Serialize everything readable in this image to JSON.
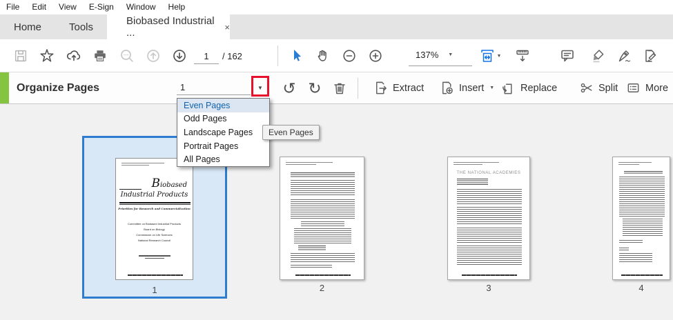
{
  "menu": {
    "items": [
      "File",
      "Edit",
      "View",
      "E-Sign",
      "Window",
      "Help"
    ]
  },
  "tabs": {
    "home": "Home",
    "tools": "Tools",
    "document": "Biobased Industrial ..."
  },
  "toolbar": {
    "page_current": "1",
    "page_total": "/ 162",
    "zoom_level": "137%"
  },
  "organize": {
    "title": "Organize Pages",
    "range_value": "1",
    "actions": {
      "extract": "Extract",
      "insert": "Insert",
      "replace": "Replace",
      "split": "Split",
      "more": "More"
    }
  },
  "dropdown": {
    "items": [
      {
        "label": "Even Pages",
        "highlighted": true
      },
      {
        "label": "Odd Pages"
      },
      {
        "label": "Landscape Pages"
      },
      {
        "label": "Portrait Pages"
      },
      {
        "label": "All Pages"
      }
    ]
  },
  "tooltip": {
    "text": "Even Pages"
  },
  "thumbnails": {
    "page1": {
      "number": "1",
      "selected": true,
      "cover": {
        "title_initial": "B",
        "title_rest": "iobased",
        "title_line2": "Industrial Products",
        "subtitle": "Priorities for Research and Commercialization",
        "lines": [
          "Committee on Biobased Industrial Products",
          "Board on Biology",
          "Commission on Life Sciences",
          "National Research Council"
        ]
      }
    },
    "page2": {
      "number": "2"
    },
    "page3": {
      "number": "3",
      "heading": "THE NATIONAL ACADEMIES"
    },
    "page4": {
      "number": "4"
    }
  },
  "icons": {
    "caret_down": "▼",
    "close": "×",
    "rotate_ccw": "↺",
    "rotate_cw": "↻"
  },
  "colors": {
    "accent_green": "#84c440",
    "selection_border": "#2d7cd0",
    "selection_fill": "#d9e8f6",
    "annotation_red": "#e8112d",
    "tool_blue": "#1473e6",
    "dropdown_highlight_text": "#0f62ad"
  }
}
